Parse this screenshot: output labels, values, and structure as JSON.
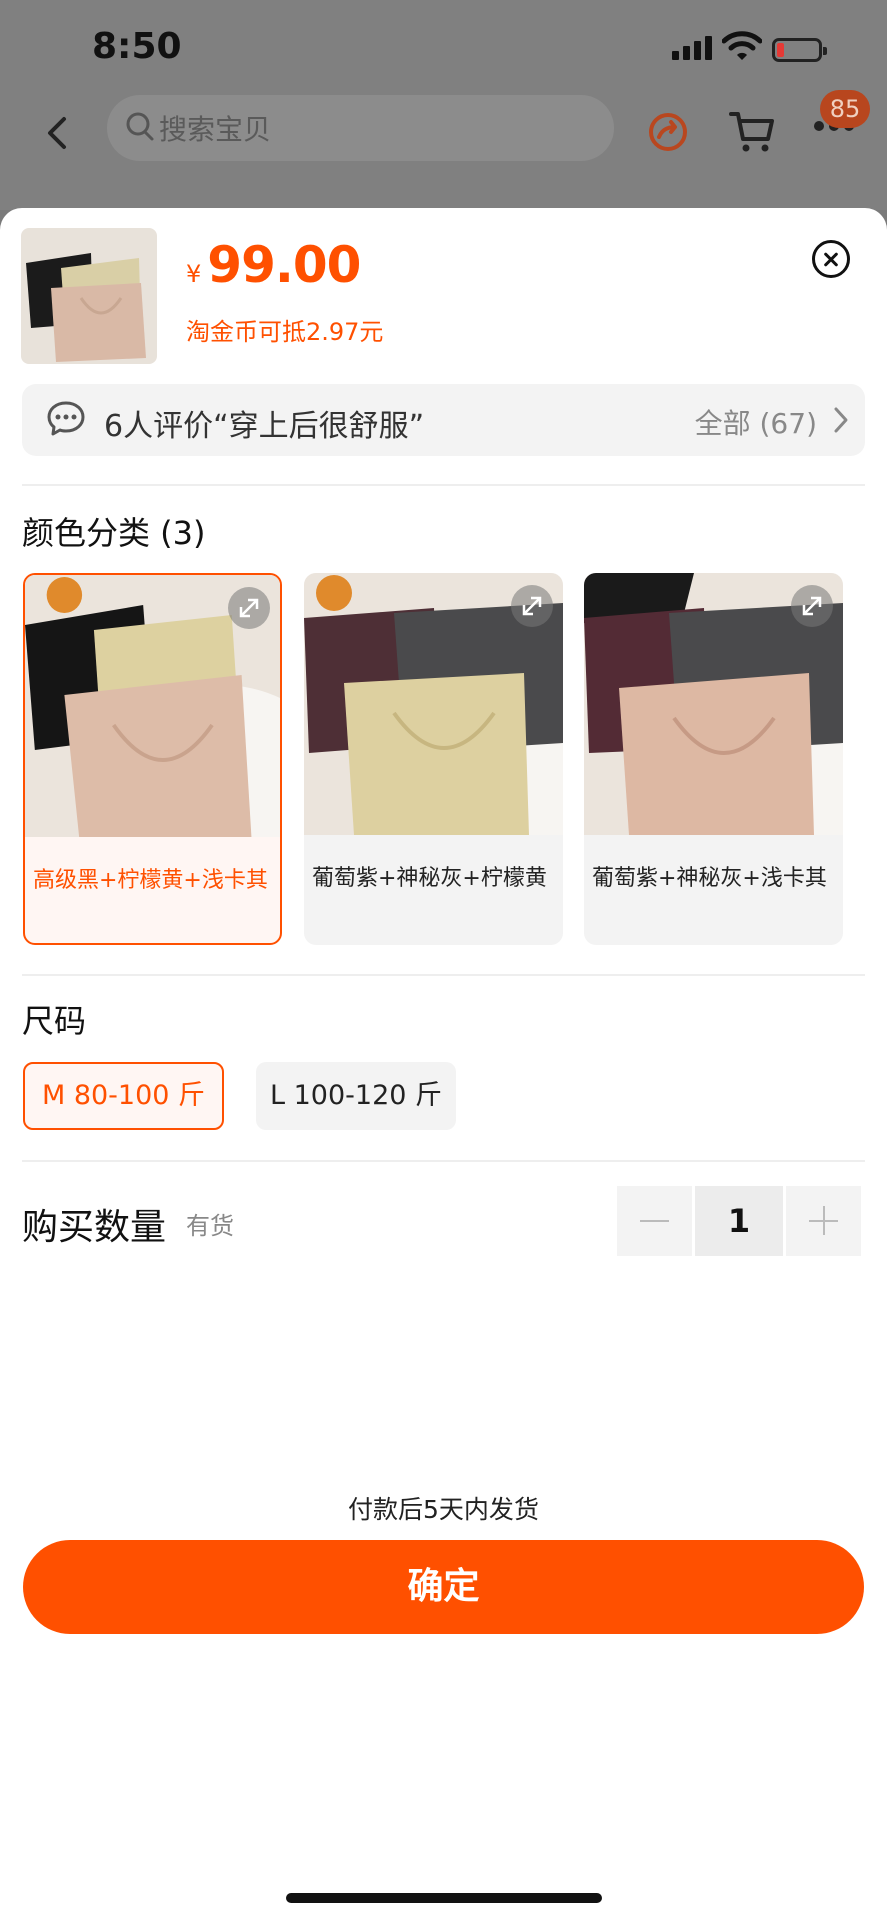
{
  "status_bar": {
    "time": "8:50"
  },
  "top_nav": {
    "search_placeholder": "搜索宝贝",
    "badge_count": "85"
  },
  "product": {
    "currency": "¥",
    "price": "99.00",
    "coin_note": "淘金币可抵2.97元"
  },
  "reviews": {
    "summary": "6人评价“穿上后很舒服”",
    "all_label": "全部 (67)"
  },
  "color_section": {
    "title": "颜色分类 (3)",
    "options": [
      {
        "label": "高级黑+柠檬黄+浅卡其",
        "selected": true
      },
      {
        "label": "葡萄紫+神秘灰+柠檬黄",
        "selected": false
      },
      {
        "label": "葡萄紫+神秘灰+浅卡其",
        "selected": false
      }
    ]
  },
  "size_section": {
    "title": "尺码",
    "options": [
      {
        "label": "M 80-100 斤",
        "selected": true
      },
      {
        "label": "L 100-120 斤",
        "selected": false
      }
    ]
  },
  "quantity": {
    "title": "购买数量",
    "stock": "有货",
    "value": "1"
  },
  "footer": {
    "ship_note": "付款后5天内发货",
    "confirm_label": "确定"
  },
  "colors": {
    "accent": "#ff5000"
  },
  "icons": [
    "back-icon",
    "search-icon",
    "share-icon",
    "cart-icon",
    "more-icon",
    "close-icon",
    "chat-icon",
    "chevron-right-icon",
    "expand-icon",
    "minus-icon",
    "plus-icon"
  ]
}
